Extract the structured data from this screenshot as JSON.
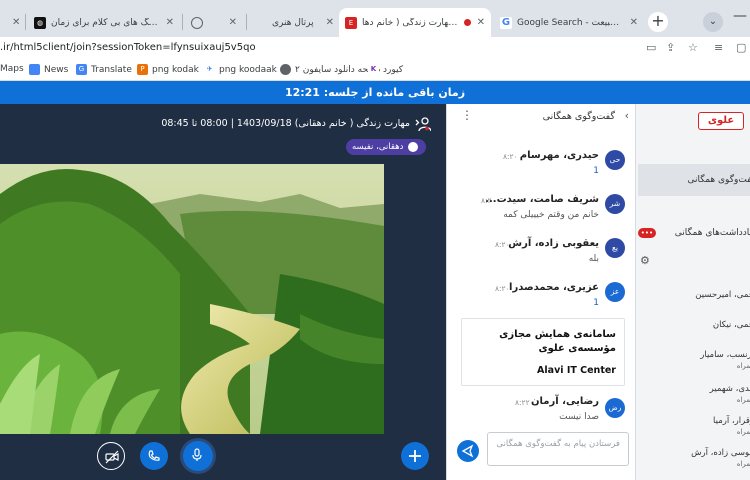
{
  "browser": {
    "tabs": [
      {
        "title": "پلی لیست آهنگ های بی کلام برای زمان",
        "favicon_color": "#111111",
        "favicon_text": "⊘"
      },
      {
        "title": "",
        "favicon_color": "#5f6368",
        "favicon_text": ""
      },
      {
        "title": "پرتال هنری",
        "favicon_color": "#5f6368",
        "favicon_text": ""
      },
      {
        "title": "هنری - مهارت زندگی ( خانم دها...",
        "favicon_color": "#d62424",
        "favicon_text": "ESP"
      },
      {
        "title": "Google Search - تصویر طبیعت",
        "favicon_color": "#4285f4",
        "favicon_text": "G"
      }
    ],
    "url": ".ir/html5client/join?sessionToken=lfynsuixauj5v5qo",
    "bookmarks": [
      {
        "label": "Maps",
        "icon": "maps-icon",
        "color": "#34a853"
      },
      {
        "label": "News",
        "icon": "news-icon",
        "color": "#4285f4"
      },
      {
        "label": "Translate",
        "icon": "translate-icon",
        "color": "#4285f4"
      },
      {
        "label": "png kodak",
        "icon": "kodak-icon",
        "color": "#e8710a"
      },
      {
        "label": "png koodaak",
        "icon": "koodaak-icon",
        "color": "#1a73e8"
      },
      {
        "label": "صفحه دانلود سایفون ۲",
        "icon": "globe-icon",
        "color": "#5f6368"
      },
      {
        "label": "کیورد",
        "icon": "keyword-icon",
        "color": "#7b2cbf"
      }
    ]
  },
  "session": {
    "timer_text": "زمان باقی مانده از جلسه: 12:21",
    "presentation_title": "مهارت زندگی ( خانم دهقانی) 1403/09/18 | 08:00 تا 08:45",
    "presenter_name": "دهقانی، نفیسه"
  },
  "chat": {
    "title": "گفت‌وگوی همگانی",
    "messages": [
      {
        "avatar": "حی",
        "avatar_color": "#2e4aa5",
        "sender": "حیدری، مهرسام",
        "time": "۸:۲۰",
        "text": "1",
        "is_num": true
      },
      {
        "avatar": "شر",
        "avatar_color": "#2e4aa5",
        "sender": "شریف صامت، سیدت...",
        "time": "۸:۲۰",
        "text": "خانم من وقتم خیییلی کمه",
        "is_num": false
      },
      {
        "avatar": "یع",
        "avatar_color": "#2e4aa5",
        "sender": "یعقوبی زاده، آرش",
        "time": "۸:۲۰",
        "text": "بله",
        "is_num": false
      },
      {
        "avatar": "عز",
        "avatar_color": "#1b6ad3",
        "sender": "عزیری، محمدصدرا",
        "time": "۸:۲۰",
        "text": "1",
        "is_num": true
      }
    ],
    "card": {
      "line1": "سامانه‌ی همایش مجازی",
      "line2": "مؤسسه‌ی علوی",
      "line3": "Alavi IT Center"
    },
    "last_message": {
      "avatar": "رض",
      "avatar_color": "#1b6ad3",
      "sender": "رضایی، آرمان",
      "time": "۸:۲۲",
      "text": "صدا نیست"
    },
    "input_placeholder": "فرستادن پیام به گفت‌وگوی همگانی"
  },
  "userpanel": {
    "logo_text": "علوی",
    "public_chat_label": "گفت‌وگوی همگانی",
    "notes_label": "یادداشت‌های همگانی",
    "notes_badge": "•••",
    "users": [
      {
        "name": "خمی، امیرحسین",
        "role": ""
      },
      {
        "name": "حمی، نیکان",
        "role": ""
      },
      {
        "name": "ارنسب، سامیار",
        "role": "همراه"
      },
      {
        "name": "مدی، شهمیر",
        "role": "همراه"
      },
      {
        "name": "رقرار، آرمیا",
        "role": "همراه"
      },
      {
        "name": "موسی زاده، آرش",
        "role": "همراه"
      }
    ]
  }
}
